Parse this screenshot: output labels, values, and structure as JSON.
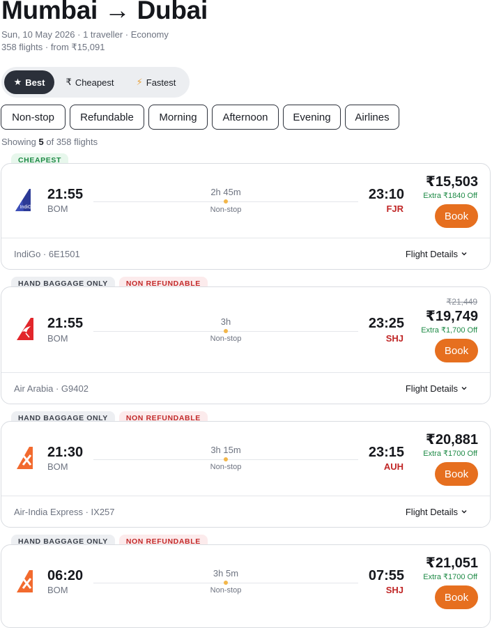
{
  "header": {
    "title": "Mumbai → Dubai",
    "subtitle": "Sun, 10 May 2026 · 1 traveller · Economy",
    "summary": "358 flights · from ₹15,091"
  },
  "sort_tabs": [
    {
      "label": "Best",
      "icon": "star-icon",
      "active": true
    },
    {
      "label": "Cheapest",
      "icon": "rupee-icon",
      "active": false
    },
    {
      "label": "Fastest",
      "icon": "lightning-icon",
      "active": false
    }
  ],
  "icons": {
    "best": "★",
    "cheapest": "₹",
    "fastest": "⚡",
    "chevron": "⌄"
  },
  "filters": [
    "Non-stop",
    "Refundable",
    "Morning",
    "Afternoon",
    "Evening",
    "Airlines"
  ],
  "showing": {
    "prefix": "Showing",
    "count": "5",
    "suffix": "of 358 flights"
  },
  "colors": {
    "accent": "#e66f1f",
    "dark": "#2b303a",
    "green": "#1d8a45",
    "red": "#c02626"
  },
  "flights": [
    {
      "tags": [
        {
          "text": "CHEAPEST",
          "style": "green"
        }
      ],
      "logo": "indigo-logo-icon",
      "logo_text": "IndiGo",
      "dep_time": "21:55",
      "dep_code": "BOM",
      "duration": "2h 45m",
      "stops": "Non-stop",
      "arr_time": "23:10",
      "arr_code": "FJR",
      "old_price": "",
      "price": "₹15,503",
      "offer": "Extra ₹1840 Off",
      "book": "Book",
      "airline": "IndiGo · 6E1501",
      "details": "Flight Details"
    },
    {
      "tags": [
        {
          "text": "HAND BAGGAGE ONLY",
          "style": "grey"
        },
        {
          "text": "NON REFUNDABLE",
          "style": "red"
        }
      ],
      "logo": "air-arabia-logo-icon",
      "dep_time": "21:55",
      "dep_code": "BOM",
      "duration": "3h",
      "stops": "Non-stop",
      "arr_time": "23:25",
      "arr_code": "SHJ",
      "old_price": "₹21,449",
      "price": "₹19,749",
      "offer": "Extra ₹1,700 Off",
      "book": "Book",
      "airline": "Air Arabia · G9402",
      "details": "Flight Details"
    },
    {
      "tags": [
        {
          "text": "HAND BAGGAGE ONLY",
          "style": "grey"
        },
        {
          "text": "NON REFUNDABLE",
          "style": "red"
        }
      ],
      "logo": "air-india-express-logo-icon",
      "dep_time": "21:30",
      "dep_code": "BOM",
      "duration": "3h 15m",
      "stops": "Non-stop",
      "arr_time": "23:15",
      "arr_code": "AUH",
      "old_price": "",
      "price": "₹20,881",
      "offer": "Extra ₹1700 Off",
      "book": "Book",
      "airline": "Air-India Express · IX257",
      "details": "Flight Details"
    },
    {
      "tags": [
        {
          "text": "HAND BAGGAGE ONLY",
          "style": "grey"
        },
        {
          "text": "NON REFUNDABLE",
          "style": "red"
        }
      ],
      "logo": "air-india-express-logo-icon",
      "dep_time": "06:20",
      "dep_code": "BOM",
      "duration": "3h 5m",
      "stops": "Non-stop",
      "arr_time": "07:55",
      "arr_code": "SHJ",
      "old_price": "",
      "price": "₹21,051",
      "offer": "Extra ₹1700 Off",
      "book": "Book",
      "airline": "",
      "details": ""
    }
  ]
}
